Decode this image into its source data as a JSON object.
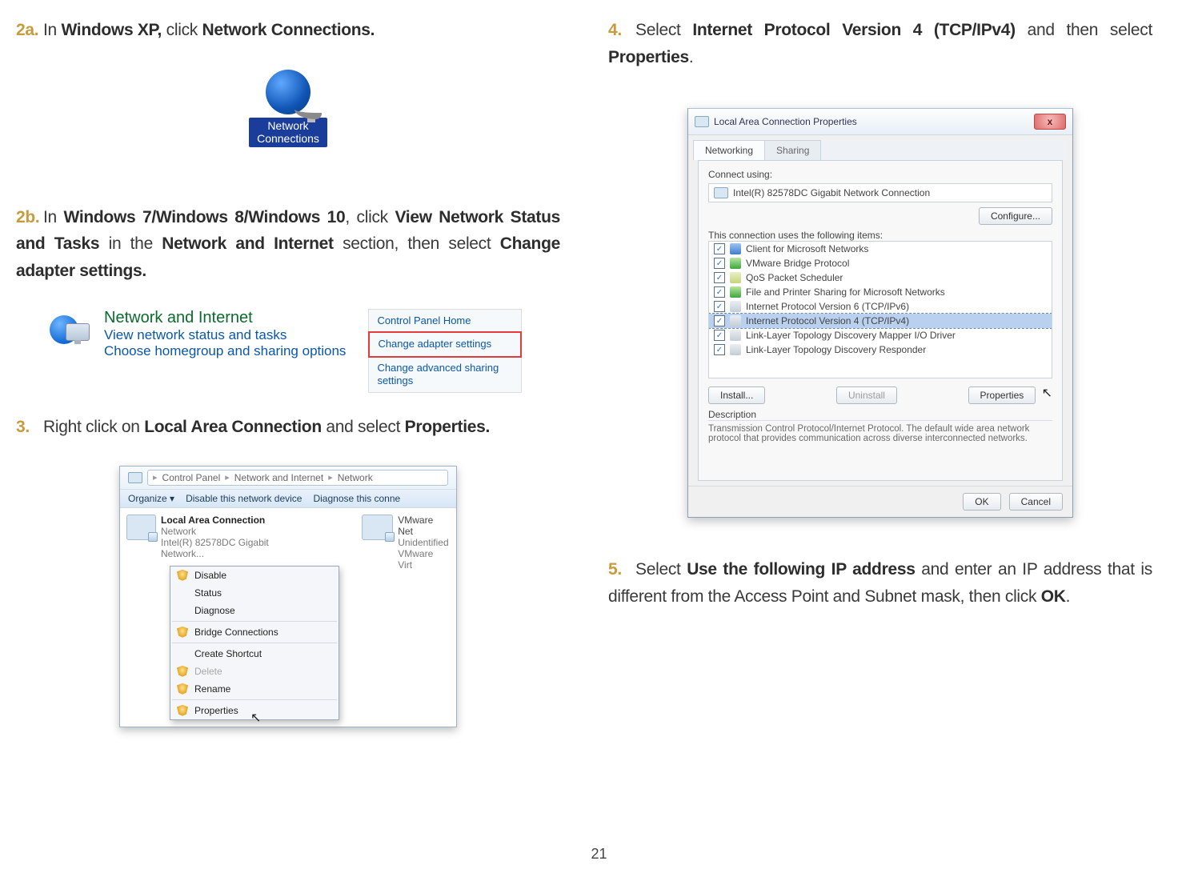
{
  "page_number": "21",
  "left": {
    "step2a": {
      "num": "2a.",
      "pre": "In ",
      "os": "Windows XP,",
      "mid": " click ",
      "action": "Network Connections."
    },
    "netconn_label": "Network\nConnections",
    "step2b": {
      "num": "2b.",
      "pre": "In ",
      "os": "Windows 7/Windows 8/Windows 10",
      "mid": ", click ",
      "action1": "View Network Status and Tasks",
      "mid2": " in the ",
      "action2": "Network and Internet",
      "mid3": " section, then select ",
      "action3": "Change adapter settings."
    },
    "ni": {
      "title": "Network and Internet",
      "link1": "View network status and tasks",
      "link2": "Choose homegroup and sharing options"
    },
    "cp": {
      "head": "Control Panel Home",
      "item1": "Change adapter settings",
      "item2": "Change advanced sharing settings"
    },
    "step3": {
      "num": "3.",
      "pre": "Right click on ",
      "action1": "Local Area Connection",
      "mid": " and select ",
      "action2": "Properties."
    },
    "lac": {
      "breadcrumb": [
        "Control Panel",
        "Network and Internet",
        "Network"
      ],
      "organize": "Organize",
      "toolbar1": "Disable this network device",
      "toolbar2": "Diagnose this conne",
      "conn_title": "Local Area Connection",
      "conn_sub1": "Network",
      "conn_sub2": "Intel(R) 82578DC Gigabit Network...",
      "conn2_title": "VMware Net",
      "conn2_sub1": "Unidentified",
      "conn2_sub2": "VMware Virt",
      "ctx": [
        "Disable",
        "Status",
        "Diagnose",
        "Bridge Connections",
        "Create Shortcut",
        "Delete",
        "Rename",
        "Properties"
      ]
    }
  },
  "right": {
    "step4": {
      "num": "4.",
      "pre": "Select ",
      "action1": "Internet Protocol Version 4 (TCP/IPv4)",
      "mid": " and then select ",
      "action2": "Properties",
      "end": "."
    },
    "prop": {
      "title": "Local Area Connection Properties",
      "tab1": "Networking",
      "tab2": "Sharing",
      "connect_label": "Connect using:",
      "adapter": "Intel(R) 82578DC Gigabit Network Connection",
      "configure": "Configure...",
      "uses_label": "This connection uses the following items:",
      "items": [
        "Client for Microsoft Networks",
        "VMware Bridge Protocol",
        "QoS Packet Scheduler",
        "File and Printer Sharing for Microsoft Networks",
        "Internet Protocol Version 6 (TCP/IPv6)",
        "Internet Protocol Version 4 (TCP/IPv4)",
        "Link-Layer Topology Discovery Mapper I/O Driver",
        "Link-Layer Topology Discovery Responder"
      ],
      "btn_install": "Install...",
      "btn_uninstall": "Uninstall",
      "btn_properties": "Properties",
      "desc_label": "Description",
      "desc_text": "Transmission Control Protocol/Internet Protocol. The default wide area network protocol that provides communication across diverse interconnected networks.",
      "ok": "OK",
      "cancel": "Cancel",
      "close_x": "x"
    },
    "step5": {
      "num": "5.",
      "pre": "Select ",
      "action": "Use the following IP address",
      "mid": " and enter an IP address that is different from the Access Point and Subnet mask, then click ",
      "ok": "OK",
      "end": "."
    }
  }
}
